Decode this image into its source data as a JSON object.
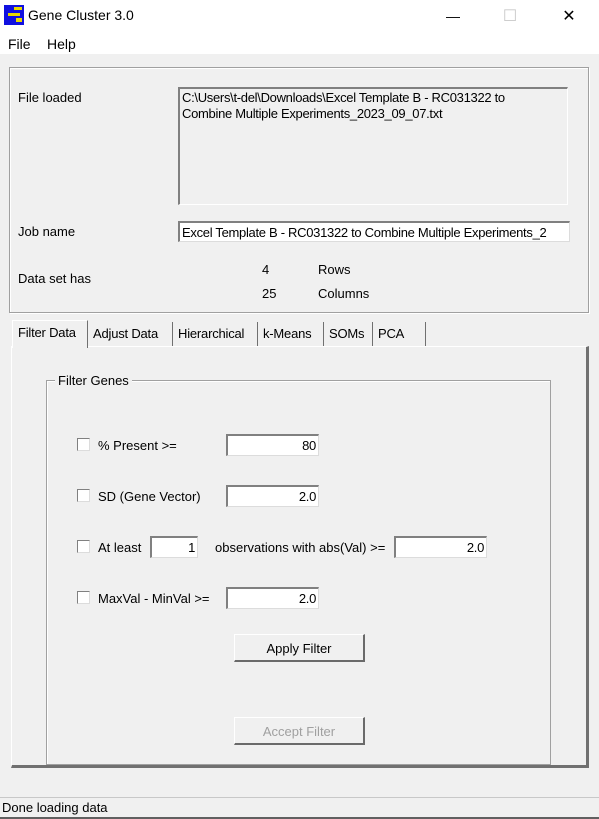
{
  "window": {
    "title": "Gene Cluster 3.0",
    "icon": "gene-cluster-app-icon",
    "controls": {
      "minimize": "—",
      "maximize": "☐",
      "close": "✕"
    }
  },
  "menu": {
    "items": [
      "File",
      "Help"
    ]
  },
  "file_info": {
    "file_loaded_label": "File loaded",
    "file_path_line1": "C:\\Users\\t-del\\Downloads\\Excel Template B - RC031322 to",
    "file_path_line2": "Combine Multiple Experiments_2023_09_07.txt",
    "job_name_label": "Job name",
    "job_name_value": "Excel Template B - RC031322 to Combine Multiple Experiments_2",
    "dataset_label": "Data set has",
    "rows_count": "4",
    "rows_label": "Rows",
    "columns_count": "25",
    "columns_label": "Columns"
  },
  "tabs": [
    "Filter Data",
    "Adjust Data",
    "Hierarchical",
    "k-Means",
    "SOMs",
    "PCA"
  ],
  "active_tab": "Filter Data",
  "filter_genes": {
    "title": "Filter Genes",
    "present": {
      "label": "% Present >=",
      "value": "80",
      "checked": false
    },
    "sd": {
      "label": "SD (Gene Vector)",
      "value": "2.0",
      "checked": false
    },
    "at_least": {
      "label": "At least",
      "count": "1",
      "middle_label": "observations with abs(Val) >=",
      "value": "2.0",
      "checked": false
    },
    "maxmin": {
      "label": "MaxVal - MinVal >=",
      "value": "2.0",
      "checked": false
    },
    "apply_button": "Apply Filter",
    "accept_button": "Accept Filter"
  },
  "status": {
    "text": "Done loading data"
  }
}
